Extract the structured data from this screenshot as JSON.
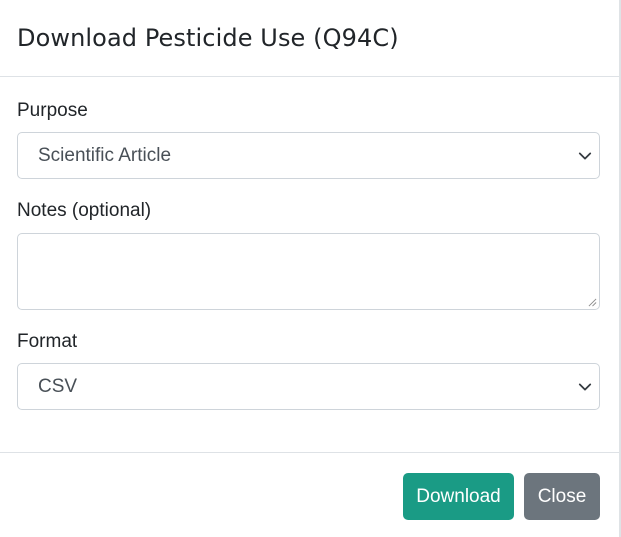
{
  "modal": {
    "title": "Download Pesticide Use (Q94C)"
  },
  "form": {
    "purpose": {
      "label": "Purpose",
      "selected": "Scientific Article"
    },
    "notes": {
      "label": "Notes (optional)",
      "value": ""
    },
    "format": {
      "label": "Format",
      "selected": "CSV"
    }
  },
  "footer": {
    "download_label": "Download",
    "close_label": "Close"
  },
  "colors": {
    "download_button": "#1a9b85",
    "close_button": "#6c757d",
    "border": "#ced4da",
    "divider": "#dee2e6"
  },
  "icons": {
    "select_arrow": "chevron-down-icon",
    "textarea_grip": "resize-handle-icon"
  }
}
